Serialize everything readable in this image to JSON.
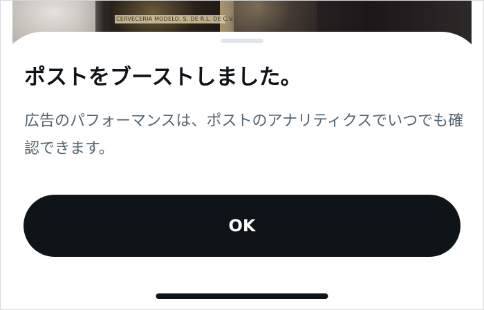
{
  "background": {
    "bottle_label": "CERVECERIA MODELO, S. DE R.L. DE C.V."
  },
  "sheet": {
    "title": "ポストをブーストしました。",
    "description": "広告のパフォーマンスは、ポストのアナリティクスでいつでも確認できます。",
    "ok_label": "OK"
  },
  "colors": {
    "text_primary": "#0f1419",
    "text_secondary": "#536471",
    "button_background": "#0f1419",
    "button_text": "#ffffff",
    "grabber": "#e1e6ea"
  }
}
